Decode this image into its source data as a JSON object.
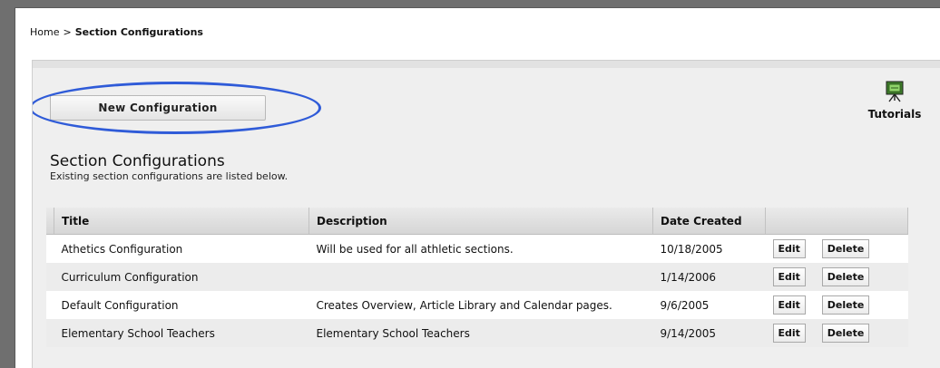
{
  "breadcrumb": {
    "home": "Home",
    "separator": ">",
    "current": "Section Configurations"
  },
  "toolbar": {
    "new_configuration_label": "New Configuration",
    "tutorials_label": "Tutorials",
    "tutorials_icon": "presentation-easel-icon"
  },
  "section": {
    "title": "Section Configurations",
    "subtitle": "Existing section configurations are listed below."
  },
  "table": {
    "columns": [
      "Title",
      "Description",
      "Date Created",
      ""
    ],
    "rows": [
      {
        "title": "Athetics Configuration",
        "description": "Will be used for all athletic sections.",
        "date": "10/18/2005",
        "edit": "Edit",
        "delete": "Delete"
      },
      {
        "title": "Curriculum Configuration",
        "description": "",
        "date": "1/14/2006",
        "edit": "Edit",
        "delete": "Delete"
      },
      {
        "title": "Default Configuration",
        "description": "Creates Overview, Article Library and Calendar pages.",
        "date": "9/6/2005",
        "edit": "Edit",
        "delete": "Delete"
      },
      {
        "title": "Elementary School Teachers",
        "description": "Elementary School Teachers",
        "date": "9/14/2005",
        "edit": "Edit",
        "delete": "Delete"
      }
    ]
  },
  "colors": {
    "highlight": "#2f5bd8",
    "header_bg": "#d6d6d6",
    "row_alt": "#ececec"
  }
}
